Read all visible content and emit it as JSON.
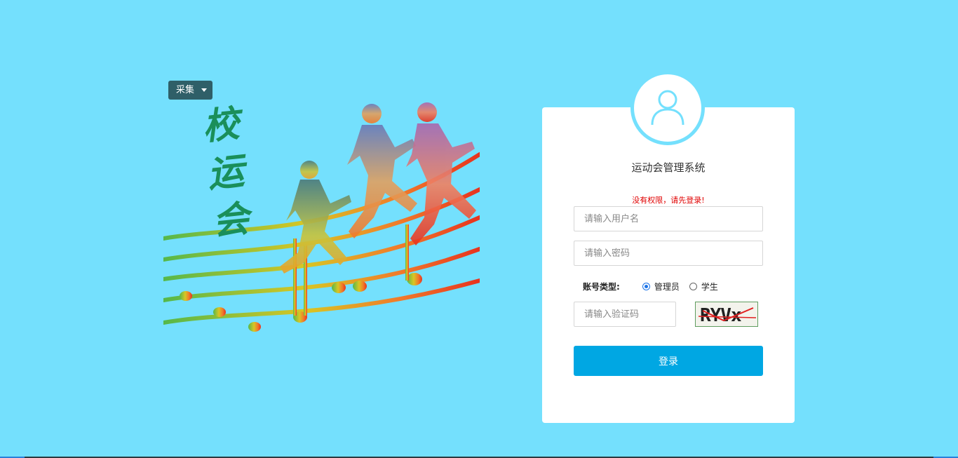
{
  "hero": {
    "collect_label": "采集",
    "title_chars": [
      "校",
      "运",
      "会"
    ]
  },
  "login": {
    "system_title": "运动会管理系统",
    "error_message": "没有权限，请先登录!",
    "username_placeholder": "请输入用户名",
    "password_placeholder": "请输入密码",
    "account_type_label": "账号类型:",
    "account_types": [
      "管理员",
      "学生"
    ],
    "selected_account_type": "管理员",
    "captcha_placeholder": "请输入验证码",
    "captcha_text": "RYVx",
    "login_label": "登录"
  },
  "colors": {
    "background": "#74e0fd",
    "primary_button": "#00a7e3",
    "error": "#e00000"
  },
  "icons": {
    "avatar": "user-icon",
    "collect_caret": "caret-down-icon"
  }
}
